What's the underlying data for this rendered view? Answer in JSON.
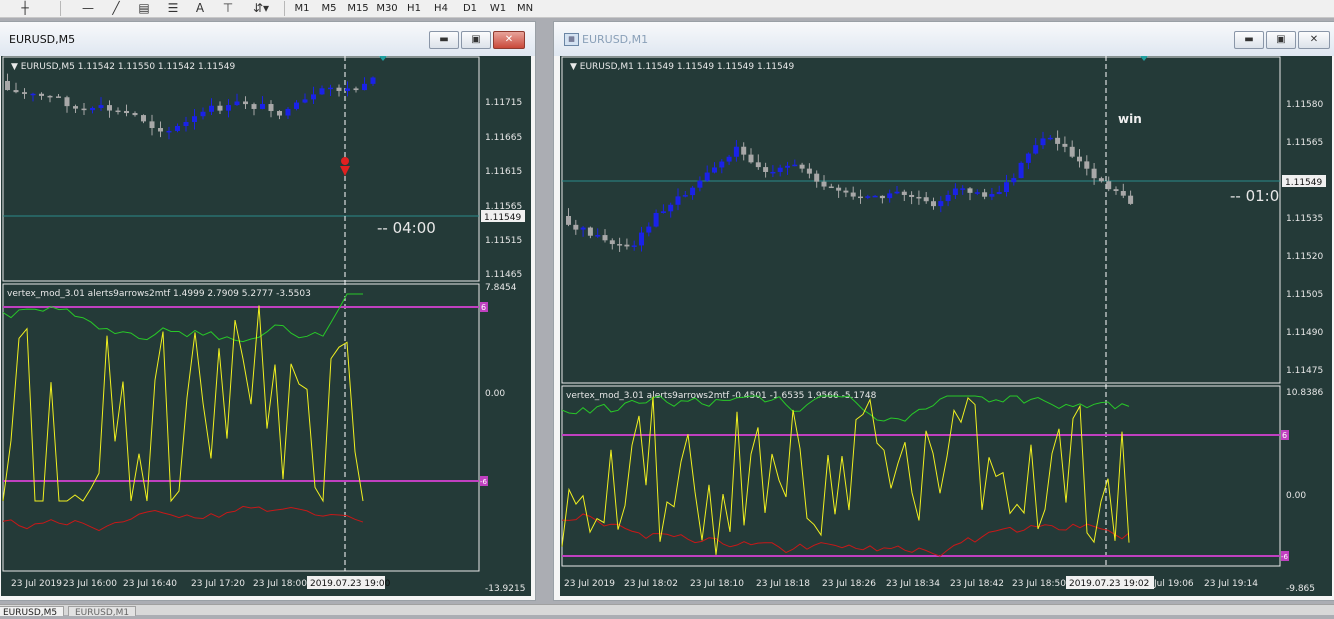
{
  "toolbar": {
    "timeframes": [
      "M1",
      "M5",
      "M15",
      "M30",
      "H1",
      "H4",
      "D1",
      "W1",
      "MN"
    ]
  },
  "bottom_tabs": [
    "EURUSD,M5",
    "EURUSD,M1"
  ],
  "windows": [
    {
      "title": "EURUSD,M5",
      "chart_header": "EURUSD,M5  1.11542 1.11550 1.11542 1.11549",
      "price_ticks": [
        "1.11715",
        "1.11665",
        "1.11615",
        "1.11565",
        "1.11515",
        "1.11465"
      ],
      "current_price": "1.11549",
      "countdown": "--  04:00",
      "indicator_header": "vertex_mod_3.01 alerts9arrows2mtf 1.4999 2.7909 5.2777 -3.5503",
      "ind_ticks": [
        "7.8454",
        "0.00",
        "-13.9215"
      ],
      "level_upper": "6",
      "level_lower": "-6",
      "time_labels": [
        "23 Jul 2019",
        "23 Jul 16:00",
        "23 Jul 16:40",
        "23 Jul 17:20",
        "23 Jul 18:00"
      ],
      "time_highlight": "2019.07.23 19:00"
    },
    {
      "title": "EURUSD,M1",
      "chart_header": "EURUSD,M1  1.11549 1.11549 1.11549 1.11549",
      "price_ticks": [
        "1.11580",
        "1.11565",
        "1.11550",
        "1.11535",
        "1.11520",
        "1.11505",
        "1.11490",
        "1.11475"
      ],
      "current_price": "1.11549",
      "countdown": "--  01:0",
      "annotation": "win",
      "indicator_header": "vertex_mod_3.01 alerts9arrows2mtf -0.4501 -1.6535 1.9566 -5.1748",
      "ind_ticks": [
        "10.8386",
        "0.00",
        "-9.865"
      ],
      "level_upper": "6",
      "level_lower": "-6",
      "time_labels": [
        "23 Jul 2019",
        "23 Jul 18:02",
        "23 Jul 18:10",
        "23 Jul 18:18",
        "23 Jul 18:26",
        "23 Jul 18:34",
        "23 Jul 18:42",
        "23 Jul 18:50",
        "Jul 19:06",
        "23 Jul 19:14"
      ],
      "time_highlight": "2019.07.23 19:02"
    }
  ],
  "colors": {
    "chart_bg": "#243a38",
    "bull": "#1a22e8",
    "bear": "#a8a8a8",
    "indicator_yellow": "#f0f020",
    "indicator_green": "#28c828",
    "indicator_red": "#c81818",
    "level_line": "#c040c0"
  }
}
